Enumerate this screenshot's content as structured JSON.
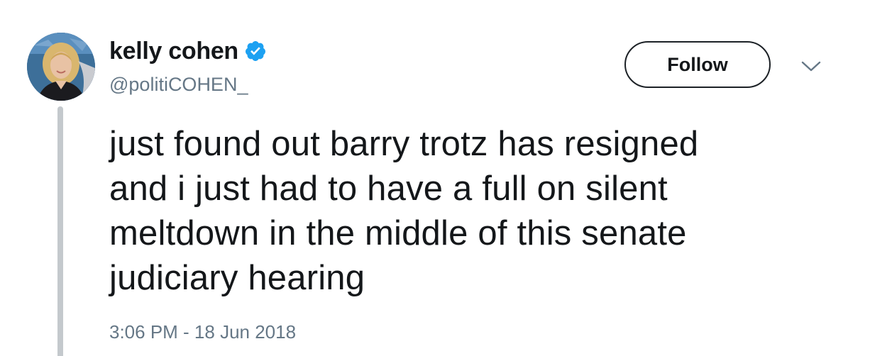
{
  "tweet": {
    "author": {
      "display_name": "kelly cohen",
      "handle": "@politiCOHEN_",
      "verified": true,
      "verified_icon": "verified-badge-icon",
      "avatar_icon": "profile-photo"
    },
    "follow_label": "Follow",
    "menu_icon": "chevron-down-icon",
    "text_lines": [
      "just found out barry trotz has resigned",
      "and i just had to have a full on silent",
      "meltdown in the middle of this senate",
      "judiciary hearing"
    ],
    "timestamp": "3:06 PM - 18 Jun 2018"
  },
  "colors": {
    "text": "#14171a",
    "secondary": "#657786",
    "verified": "#1da1f2",
    "thread_line": "#c4c9cd"
  }
}
